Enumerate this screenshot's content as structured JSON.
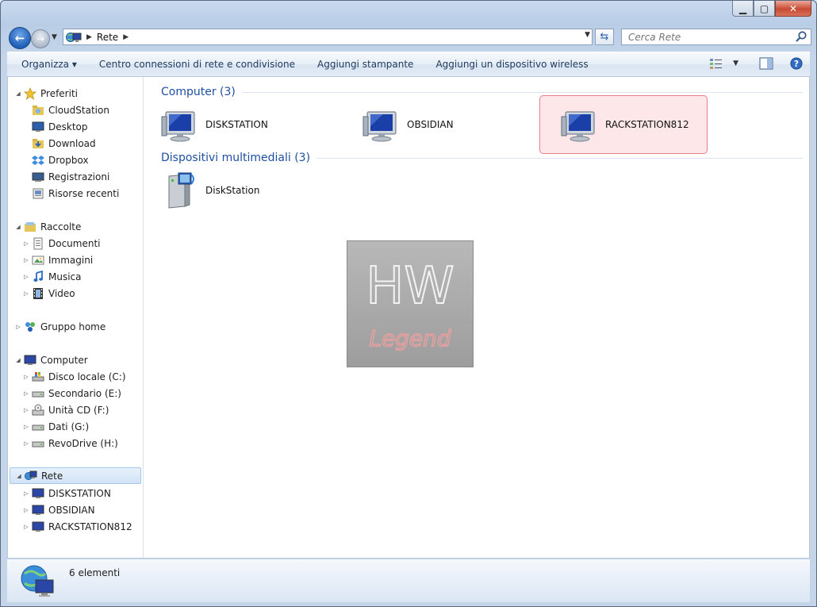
{
  "address": {
    "root_label": "Rete",
    "current_label": "Rete"
  },
  "search": {
    "placeholder": "Cerca Rete"
  },
  "toolbar": {
    "organize": "Organizza ▾",
    "network_center": "Centro connessioni di rete e condivisione",
    "add_printer": "Aggiungi stampante",
    "add_wireless": "Aggiungi un dispositivo wireless"
  },
  "sidebar": {
    "favorites": {
      "label": "Preferiti",
      "items": [
        "CloudStation",
        "Desktop",
        "Download",
        "Dropbox",
        "Registrazioni",
        "Risorse recenti"
      ]
    },
    "libraries": {
      "label": "Raccolte",
      "items": [
        "Documenti",
        "Immagini",
        "Musica",
        "Video"
      ]
    },
    "homegroup": {
      "label": "Gruppo home"
    },
    "computer": {
      "label": "Computer",
      "items": [
        "Disco locale (C:)",
        "Secondario (E:)",
        "Unità CD (F:)",
        "Dati (G:)",
        "RevoDrive (H:)"
      ]
    },
    "network": {
      "label": "Rete",
      "items": [
        "DISKSTATION",
        "OBSIDIAN",
        "RACKSTATION812"
      ]
    }
  },
  "groups": {
    "computer": {
      "title": "Computer (3)",
      "items": [
        "DISKSTATION",
        "OBSIDIAN",
        "RACKSTATION812"
      ]
    },
    "media": {
      "title": "Dispositivi multimediali (3)",
      "items": [
        "DiskStation"
      ]
    }
  },
  "watermark": {
    "line1": "HW",
    "line2": "Legend"
  },
  "status": {
    "text": "6 elementi"
  },
  "colors": {
    "accent": "#1e4fa3",
    "selection_border": "#e7808a",
    "selection_fill": "#fde7e9"
  }
}
